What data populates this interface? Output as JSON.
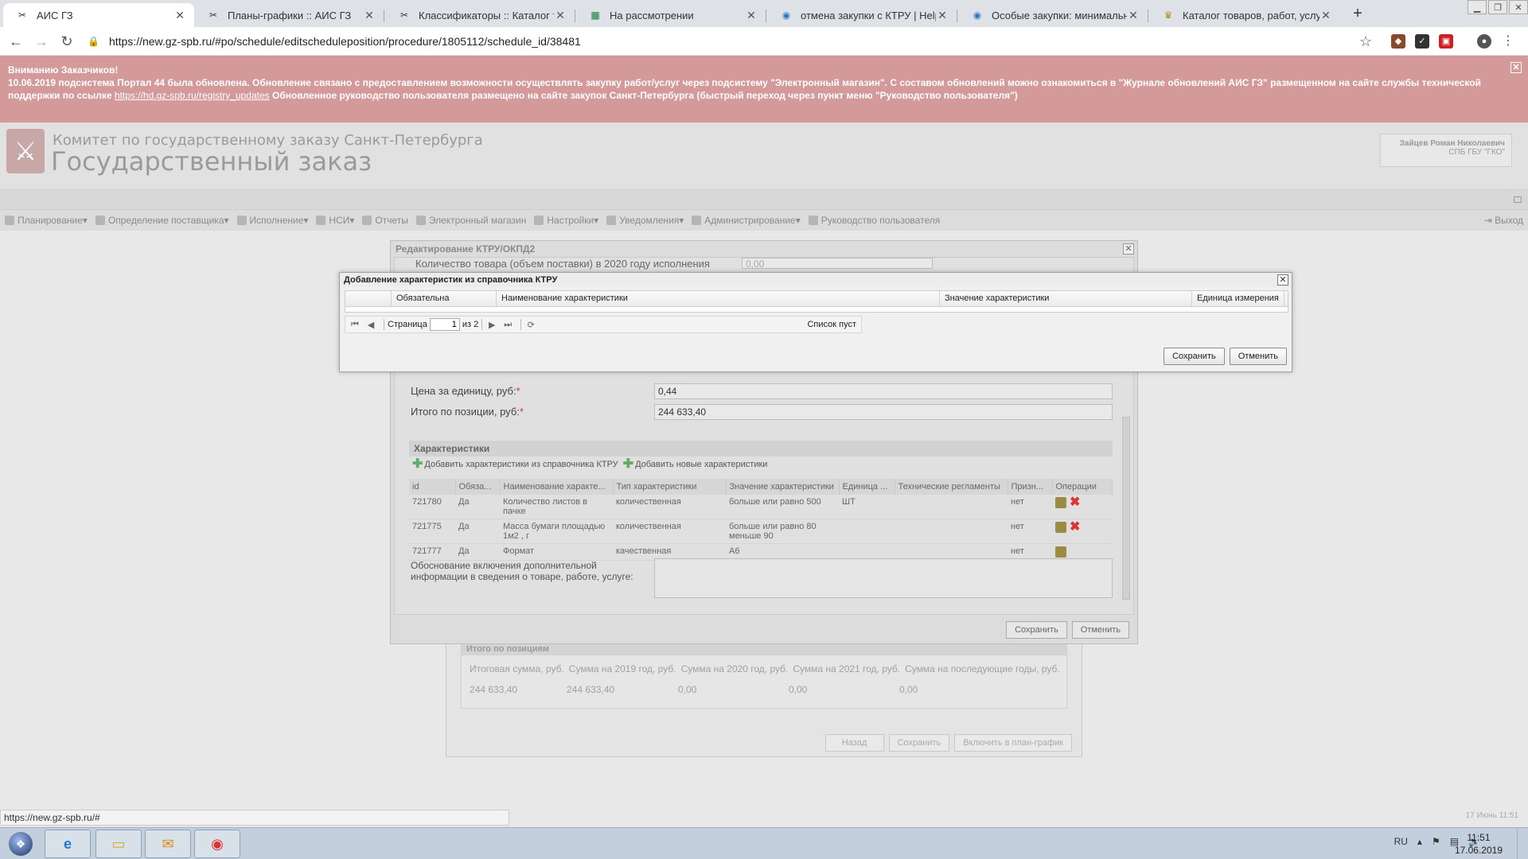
{
  "browser": {
    "tabs": [
      {
        "title": "АИС ГЗ",
        "icon": "ais-icon"
      },
      {
        "title": "Планы-графики :: АИС ГЗ",
        "icon": "ais-icon"
      },
      {
        "title": "Классификаторы :: Каталог това",
        "icon": "ais-icon"
      },
      {
        "title": "На рассмотрении",
        "icon": "sheet-icon"
      },
      {
        "title": "отмена закупки с КТРУ | HelpDe",
        "icon": "globe-icon"
      },
      {
        "title": "Особые закупки: минимальная",
        "icon": "globe-icon"
      },
      {
        "title": "Каталог товаров, работ, услуг д",
        "icon": "emblem-icon"
      }
    ],
    "url": "https://new.gz-spb.ru/#po/schedule/editscheduleposition/procedure/1805112/schedule_id/38481",
    "status_url": "https://new.gz-spb.ru/#"
  },
  "banner": {
    "title": "Вниманию Заказчиков!",
    "text1": "10.06.2019 подсистема Портал 44 была обновлена. Обновление связано с предоставлением возможности осуществлять закупку работ/услуг через подсистему \"Электронный магазин\". С составом обновлений можно ознакомиться в \"Журнале обновлений АИС ГЗ\" размещенном на сайте службы технической поддержки по ссылке",
    "link": "https://hd.gz-spb.ru/registry_updates",
    "text2": "Обновленное руководство пользователя размещено на сайте закупок Санкт-Петербурга (быстрый переход через пункт меню \"Руководство пользователя\")"
  },
  "header": {
    "org_line": "Комитет по государственному заказу Санкт-Петербурга",
    "app_title": "Государственный заказ",
    "user_name": "Зайцев Роман Николаевич",
    "user_org": "СПБ ГБУ \"ГКО\""
  },
  "menu": {
    "items": [
      "Планирование",
      "Определение поставщика",
      "Исполнение",
      "НСИ",
      "Отчеты",
      "Электронный магазин",
      "Настройки",
      "Уведомления",
      "Администрирование",
      "Руководство пользователя"
    ],
    "exit": "Выход"
  },
  "edit_window": {
    "title": "Редактирование КТРУ/ОКПД2",
    "top_field_label": "Количество товара (объем поставки) в 2020 году исполнения",
    "top_field_value": "0,00",
    "price_label": "Цена за единицу, руб:",
    "price_value": "0,44",
    "total_label": "Итого по позиции, руб:",
    "total_value": "244 633,40",
    "chars_header": "Характеристики",
    "add_from_ktru": "Добавить характеристики из справочника КТРУ",
    "add_new": "Добавить новые характеристики",
    "columns": [
      "id",
      "Обяза...",
      "Наименование характе...",
      "Тип характеристики",
      "Значение характеристики",
      "Единица ...",
      "Технические регламенты",
      "Призн...",
      "Операции"
    ],
    "rows": [
      {
        "id": "721780",
        "req": "Да",
        "name": "Количество листов в пачке",
        "type": "количественная",
        "value": "больше или равно 500",
        "unit": "ШТ",
        "reg": "",
        "sign": "нет",
        "deletable": true
      },
      {
        "id": "721775",
        "req": "Да",
        "name": "Масса бумаги площадью 1м2 , г",
        "type": "количественная",
        "value": "больше или равно 80 меньше 90",
        "unit": "",
        "reg": "",
        "sign": "нет",
        "deletable": true
      },
      {
        "id": "721777",
        "req": "Да",
        "name": "Формат",
        "type": "качественная",
        "value": "А6",
        "unit": "",
        "reg": "",
        "sign": "нет",
        "deletable": false
      }
    ],
    "justification_label": "Обоснование включения дополнительной информации в сведения о товаре, работе, услуге:",
    "save": "Сохранить",
    "cancel": "Отменить"
  },
  "bg_panel": {
    "title": "Итого по позициям",
    "cols": [
      "Итоговая сумма, руб.",
      "Сумма на 2019 год, руб.",
      "Сумма на 2020 год, руб.",
      "Сумма на 2021 год, руб.",
      "Сумма на последующие годы, руб."
    ],
    "vals": [
      "244 633,40",
      "244 633,40",
      "0,00",
      "0,00",
      "0,00"
    ],
    "back": "Назад",
    "save": "Сохранить",
    "include": "Включить в план-график"
  },
  "dialog": {
    "title": "Добавление характеристик из справочника КТРУ",
    "columns": [
      "",
      "Обязательна",
      "Наименование характеристики",
      "Значение характеристики",
      "Единица измерения"
    ],
    "page_label": "Страница",
    "page_value": "1",
    "page_of": "из 2",
    "empty_text": "Список пуст",
    "save": "Сохранить",
    "cancel": "Отменить"
  },
  "footer": {
    "datetime": "17 Июнь 11:51"
  },
  "taskbar": {
    "lang": "RU",
    "time": "11:51",
    "date": "17.06.2019"
  }
}
